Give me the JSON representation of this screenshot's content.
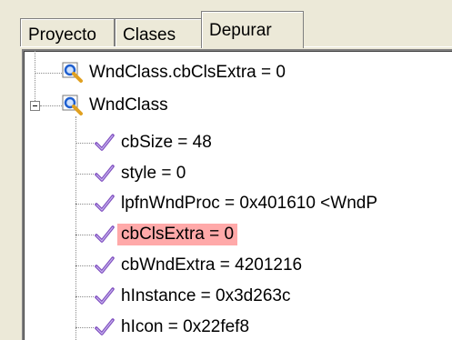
{
  "tabs": [
    {
      "label": "Proyecto",
      "active": false
    },
    {
      "label": "Clases",
      "active": false
    },
    {
      "label": "Depurar",
      "active": true
    }
  ],
  "tree": {
    "watch1": {
      "text": "WndClass.cbClsExtra = 0",
      "icon": "magnifier-watch-icon"
    },
    "watch2": {
      "text": "WndClass",
      "icon": "magnifier-watch-icon",
      "expanded": true
    },
    "members": [
      {
        "text": "cbSize = 48",
        "icon": "checkmark-icon"
      },
      {
        "text": "style = 0",
        "icon": "checkmark-icon"
      },
      {
        "text": "lpfnWndProc = 0x401610 <WndP",
        "icon": "checkmark-icon"
      },
      {
        "text": "cbClsExtra = 0",
        "icon": "checkmark-icon",
        "highlighted": true
      },
      {
        "text": "cbWndExtra = 4201216",
        "icon": "checkmark-icon"
      },
      {
        "text": "hInstance = 0x3d263c",
        "icon": "checkmark-icon"
      },
      {
        "text": "hIcon = 0x22fef8",
        "icon": "checkmark-icon"
      }
    ]
  },
  "colors": {
    "highlight": "#ffa9a9",
    "check": "#8050c0",
    "lens": "#1f5fcf",
    "handle": "#e0a020"
  }
}
